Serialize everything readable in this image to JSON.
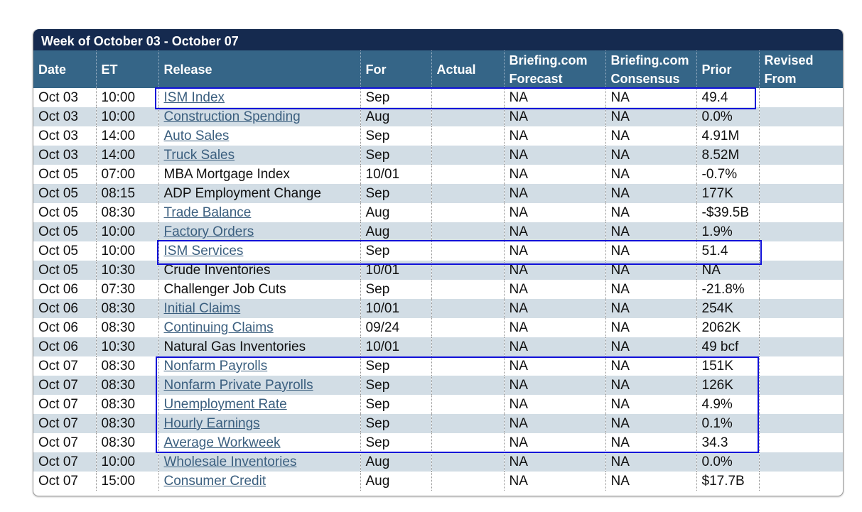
{
  "calendar": {
    "week_title": "Week of October 03 - October 07",
    "columns": [
      "Date",
      "ET",
      "Release",
      "For",
      "Actual",
      "Briefing.com\nForecast",
      "Briefing.com\nConsensus",
      "Prior",
      "Revised\nFrom"
    ],
    "column_headers": {
      "date": "Date",
      "et": "ET",
      "release": "Release",
      "for": "For",
      "actual": "Actual",
      "forecast_line1": "Briefing.com",
      "forecast_line2": "Forecast",
      "consensus_line1": "Briefing.com",
      "consensus_line2": "Consensus",
      "prior": "Prior",
      "revised_line1": "Revised",
      "revised_line2": "From"
    },
    "rows": [
      {
        "date": "Oct 03",
        "et": "10:00",
        "release": "ISM Index",
        "link": true,
        "for": "Sep",
        "actual": "",
        "forecast": "NA",
        "consensus": "NA",
        "prior": "49.4",
        "revised": "",
        "highlighted": true
      },
      {
        "date": "Oct 03",
        "et": "10:00",
        "release": "Construction Spending",
        "link": true,
        "for": "Aug",
        "actual": "",
        "forecast": "NA",
        "consensus": "NA",
        "prior": "0.0%",
        "revised": ""
      },
      {
        "date": "Oct 03",
        "et": "14:00",
        "release": "Auto Sales",
        "link": true,
        "for": "Sep",
        "actual": "",
        "forecast": "NA",
        "consensus": "NA",
        "prior": "4.91M",
        "revised": ""
      },
      {
        "date": "Oct 03",
        "et": "14:00",
        "release": "Truck Sales",
        "link": true,
        "for": "Sep",
        "actual": "",
        "forecast": "NA",
        "consensus": "NA",
        "prior": "8.52M",
        "revised": ""
      },
      {
        "date": "Oct 05",
        "et": "07:00",
        "release": "MBA Mortgage Index",
        "link": false,
        "for": "10/01",
        "actual": "",
        "forecast": "NA",
        "consensus": "NA",
        "prior": "-0.7%",
        "revised": ""
      },
      {
        "date": "Oct 05",
        "et": "08:15",
        "release": "ADP Employment Change",
        "link": false,
        "for": "Sep",
        "actual": "",
        "forecast": "NA",
        "consensus": "NA",
        "prior": "177K",
        "revised": ""
      },
      {
        "date": "Oct 05",
        "et": "08:30",
        "release": "Trade Balance",
        "link": true,
        "for": "Aug",
        "actual": "",
        "forecast": "NA",
        "consensus": "NA",
        "prior": "-$39.5B",
        "revised": ""
      },
      {
        "date": "Oct 05",
        "et": "10:00",
        "release": "Factory Orders",
        "link": true,
        "for": "Aug",
        "actual": "",
        "forecast": "NA",
        "consensus": "NA",
        "prior": "1.9%",
        "revised": ""
      },
      {
        "date": "Oct 05",
        "et": "10:00",
        "release": "ISM Services",
        "link": true,
        "for": "Sep",
        "actual": "",
        "forecast": "NA",
        "consensus": "NA",
        "prior": "51.4",
        "revised": "",
        "highlighted": true
      },
      {
        "date": "Oct 05",
        "et": "10:30",
        "release": "Crude Inventories",
        "link": false,
        "for": "10/01",
        "actual": "",
        "forecast": "NA",
        "consensus": "NA",
        "prior": "NA",
        "revised": ""
      },
      {
        "date": "Oct 06",
        "et": "07:30",
        "release": "Challenger Job Cuts",
        "link": false,
        "for": "Sep",
        "actual": "",
        "forecast": "NA",
        "consensus": "NA",
        "prior": "-21.8%",
        "revised": ""
      },
      {
        "date": "Oct 06",
        "et": "08:30",
        "release": "Initial Claims",
        "link": true,
        "for": "10/01",
        "actual": "",
        "forecast": "NA",
        "consensus": "NA",
        "prior": "254K",
        "revised": ""
      },
      {
        "date": "Oct 06",
        "et": "08:30",
        "release": "Continuing Claims",
        "link": true,
        "for": "09/24",
        "actual": "",
        "forecast": "NA",
        "consensus": "NA",
        "prior": "2062K",
        "revised": ""
      },
      {
        "date": "Oct 06",
        "et": "10:30",
        "release": "Natural Gas Inventories",
        "link": false,
        "for": "10/01",
        "actual": "",
        "forecast": "NA",
        "consensus": "NA",
        "prior": "49 bcf",
        "revised": ""
      },
      {
        "date": "Oct 07",
        "et": "08:30",
        "release": "Nonfarm Payrolls",
        "link": true,
        "for": "Sep",
        "actual": "",
        "forecast": "NA",
        "consensus": "NA",
        "prior": "151K",
        "revised": "",
        "highlighted": true
      },
      {
        "date": "Oct 07",
        "et": "08:30",
        "release": "Nonfarm Private Payrolls",
        "link": true,
        "for": "Sep",
        "actual": "",
        "forecast": "NA",
        "consensus": "NA",
        "prior": "126K",
        "revised": "",
        "highlighted": true
      },
      {
        "date": "Oct 07",
        "et": "08:30",
        "release": "Unemployment Rate",
        "link": true,
        "for": "Sep",
        "actual": "",
        "forecast": "NA",
        "consensus": "NA",
        "prior": "4.9%",
        "revised": "",
        "highlighted": true
      },
      {
        "date": "Oct 07",
        "et": "08:30",
        "release": "Hourly Earnings",
        "link": true,
        "for": "Sep",
        "actual": "",
        "forecast": "NA",
        "consensus": "NA",
        "prior": "0.1%",
        "revised": "",
        "highlighted": true
      },
      {
        "date": "Oct 07",
        "et": "08:30",
        "release": "Average Workweek",
        "link": true,
        "for": "Sep",
        "actual": "",
        "forecast": "NA",
        "consensus": "NA",
        "prior": "34.3",
        "revised": "",
        "highlighted": true
      },
      {
        "date": "Oct 07",
        "et": "10:00",
        "release": "Wholesale Inventories",
        "link": true,
        "for": "Aug",
        "actual": "",
        "forecast": "NA",
        "consensus": "NA",
        "prior": "0.0%",
        "revised": ""
      },
      {
        "date": "Oct 07",
        "et": "15:00",
        "release": "Consumer Credit",
        "link": true,
        "for": "Aug",
        "actual": "",
        "forecast": "NA",
        "consensus": "NA",
        "prior": "$17.7B",
        "revised": ""
      }
    ]
  },
  "colors": {
    "title_bar": "#152a4f",
    "header_bar": "#356587",
    "alt_row": "#d2dde5",
    "link": "#3b5f7f",
    "highlight_box": "#1010d8"
  }
}
